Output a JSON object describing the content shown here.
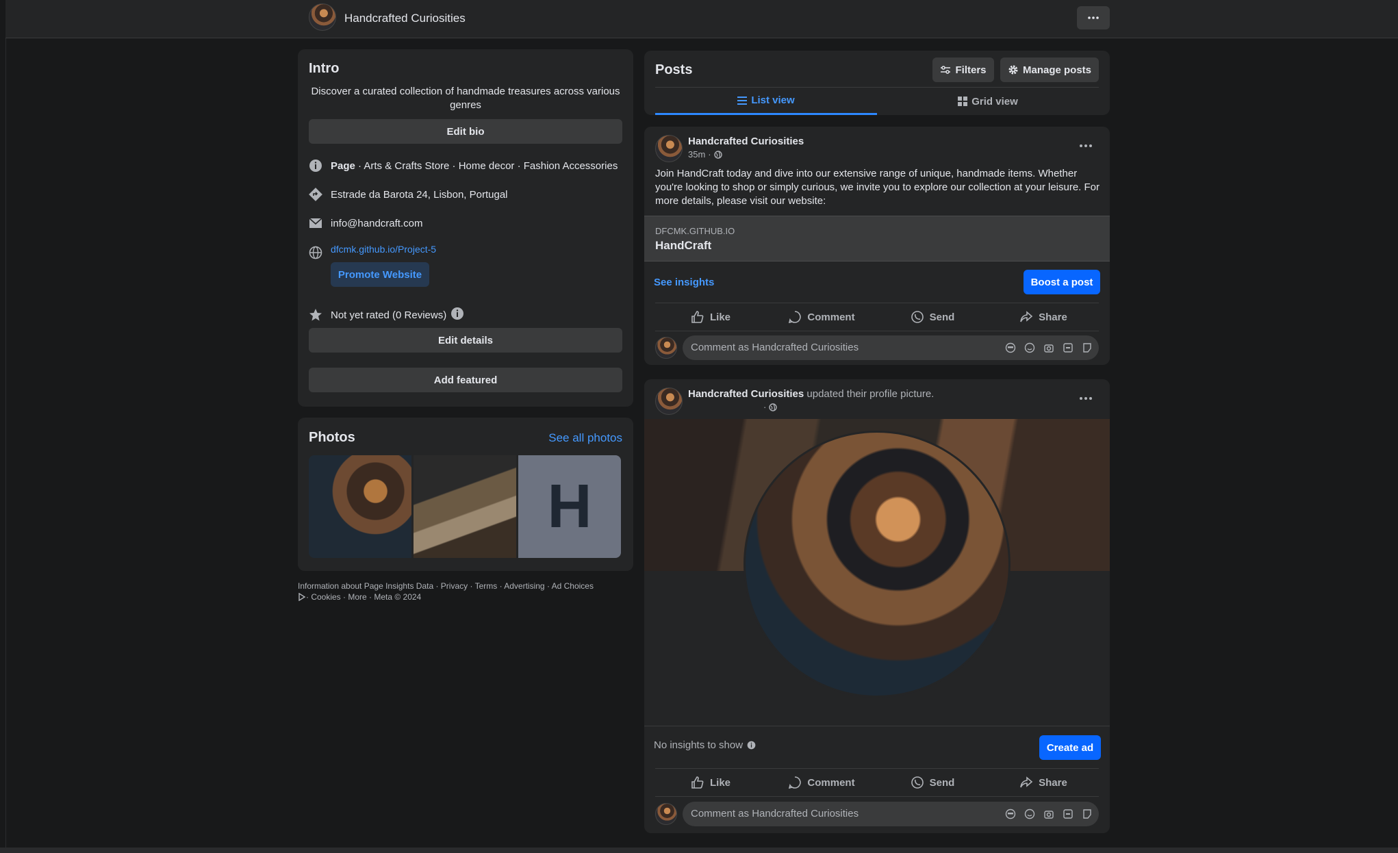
{
  "page": {
    "name": "Handcrafted Curiosities"
  },
  "intro": {
    "title": "Intro",
    "bio": "Discover a curated collection of handmade treasures across various genres",
    "edit_bio": "Edit bio",
    "category_label": "Page",
    "category_rest": " · Arts & Crafts Store · Home decor · Fashion Accessories",
    "address": "Estrade da Barota 24, Lisbon, Portugal",
    "email": "info@handcraft.com",
    "website": "dfcmk.github.io/Project-5",
    "promote": "Promote Website",
    "rating": "Not yet rated (0 Reviews)",
    "edit_details": "Edit details",
    "add_featured": "Add featured"
  },
  "photos": {
    "title": "Photos",
    "see_all": "See all photos",
    "placeholder_letter": "H"
  },
  "footer": {
    "line1": "Information about Page Insights Data · Privacy · Terms · Advertising · Ad Choices",
    "line2": " · Cookies · More · Meta © 2024"
  },
  "posts": {
    "title": "Posts",
    "filters": "Filters",
    "manage": "Manage posts",
    "tab_list": "List view",
    "tab_grid": "Grid view"
  },
  "post1": {
    "author": "Handcrafted Curiosities",
    "time": "35m",
    "body": "Join HandCraft today and dive into our extensive range of unique, handmade items. Whether you're looking to shop or simply curious, we invite you to explore our collection at your leisure. For more details, please visit our website:",
    "link_domain": "DFCMK.GITHUB.IO",
    "link_name": "HandCraft",
    "see_insights": "See insights",
    "boost": "Boost a post"
  },
  "post2": {
    "author": "Handcrafted Curiosities",
    "action": " updated their profile picture.",
    "no_insights": "No insights to show",
    "create_ad": "Create ad"
  },
  "actions": {
    "like": "Like",
    "comment": "Comment",
    "send": "Send",
    "share": "Share"
  },
  "comment_placeholder": "Comment as Handcrafted Curiosities",
  "colors": {
    "accent": "#0866ff",
    "link": "#4599ff",
    "card": "#242526",
    "bg": "#18191a"
  }
}
